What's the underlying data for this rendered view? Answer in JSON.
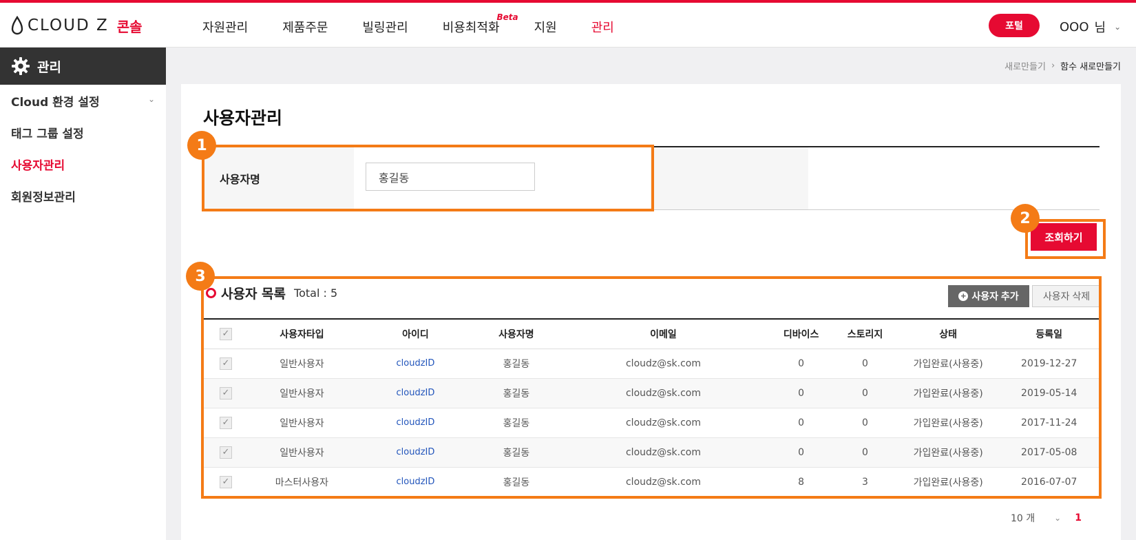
{
  "colors": {
    "accent": "#e60a32",
    "highlight": "#f47b16",
    "sidebar_head": "#333333"
  },
  "header": {
    "logo_text": "CLOUD Z",
    "logo_sub": "콘솔",
    "nav": [
      {
        "label": "자원관리"
      },
      {
        "label": "제품주문"
      },
      {
        "label": "빌링관리"
      },
      {
        "label": "비용최적화",
        "badge": "Beta"
      },
      {
        "label": "지원"
      },
      {
        "label": "관리"
      }
    ],
    "active_nav": "관리",
    "portal_label": "포털",
    "user_name": "OOO",
    "user_suffix": "님"
  },
  "sidebar": {
    "title": "관리",
    "items": [
      {
        "label": "Cloud 환경 설정"
      },
      {
        "label": "태그 그룹 설정"
      },
      {
        "label": "사용자관리"
      },
      {
        "label": "회원정보관리"
      }
    ],
    "active_item": "사용자관리"
  },
  "breadcrumb": {
    "parent": "새로만들기",
    "current": "함수 새로만들기"
  },
  "main": {
    "title": "사용자관리",
    "search": {
      "label": "사용자명",
      "value": "홍길동"
    },
    "search_button": "조회하기",
    "list": {
      "title": "사용자 목록",
      "total": "Total : 5",
      "add_button": "사용자 추가",
      "delete_button": "사용자 삭제",
      "columns": [
        "사용자타입",
        "아이디",
        "사용자명",
        "이메일",
        "디바이스",
        "스토리지",
        "상태",
        "등록일"
      ],
      "rows": [
        {
          "type": "일반사용자",
          "id": "cloudzID",
          "name": "홍길동",
          "email": "cloudz@sk.com",
          "devices": "0",
          "storage": "0",
          "status": "가입완료(사용중)",
          "date": "2019-12-27"
        },
        {
          "type": "일반사용자",
          "id": "cloudzID",
          "name": "홍길동",
          "email": "cloudz@sk.com",
          "devices": "0",
          "storage": "0",
          "status": "가입완료(사용중)",
          "date": "2019-05-14"
        },
        {
          "type": "일반사용자",
          "id": "cloudzID",
          "name": "홍길동",
          "email": "cloudz@sk.com",
          "devices": "0",
          "storage": "0",
          "status": "가입완료(사용중)",
          "date": "2017-11-24"
        },
        {
          "type": "일반사용자",
          "id": "cloudzID",
          "name": "홍길동",
          "email": "cloudz@sk.com",
          "devices": "0",
          "storage": "0",
          "status": "가입완료(사용중)",
          "date": "2017-05-08"
        },
        {
          "type": "마스터사용자",
          "id": "cloudzID",
          "name": "홍길동",
          "email": "cloudz@sk.com",
          "devices": "8",
          "storage": "3",
          "status": "가입완료(사용중)",
          "date": "2016-07-07"
        }
      ]
    },
    "pagination": {
      "page_size": "10 개",
      "current_page": "1"
    }
  },
  "annotations": [
    "1",
    "2",
    "3"
  ]
}
